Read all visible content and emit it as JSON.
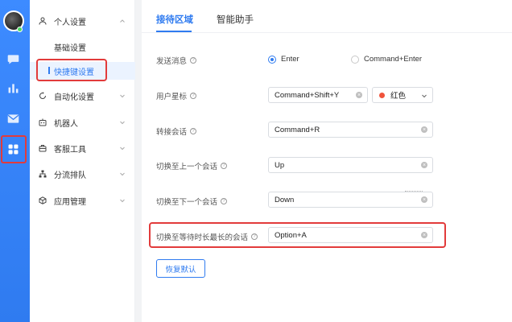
{
  "rail": {
    "items": [
      {
        "name": "chat-bubble-icon"
      },
      {
        "name": "bar-chart-icon"
      },
      {
        "name": "mail-icon"
      },
      {
        "name": "apps-grid-icon"
      }
    ],
    "active_color": "#ffffff",
    "bg_color": "#2f7bf0"
  },
  "sidebar": {
    "personal_settings": "个人设置",
    "basic_settings": "基础设置",
    "shortcut_settings": "快捷键设置",
    "automation": "自动化设置",
    "robot": "机器人",
    "service_tools": "客服工具",
    "routing": "分流排队",
    "app_management": "应用管理"
  },
  "tabs": {
    "reception": "接待区域",
    "assistant": "智能助手"
  },
  "form": {
    "send_message": {
      "label": "发送消息",
      "option_enter": "Enter",
      "option_cmd_enter": "Command+Enter",
      "selected": "Enter"
    },
    "user_star": {
      "label": "用户星标",
      "value": "Command+Shift+Y",
      "color_label": "红色",
      "color": "#f0533b"
    },
    "transfer": {
      "label": "转接会话",
      "value": "Command+R"
    },
    "prev_conv": {
      "label": "切换至上一个会话",
      "value": "Up"
    },
    "next_conv": {
      "label": "切换至下一个会话",
      "value": "Down"
    },
    "longest_wait": {
      "label": "切换至等待时长最长的会话",
      "value": "Option+A"
    }
  },
  "buttons": {
    "restore_default": "恢复默认"
  },
  "help_glyph": "?"
}
